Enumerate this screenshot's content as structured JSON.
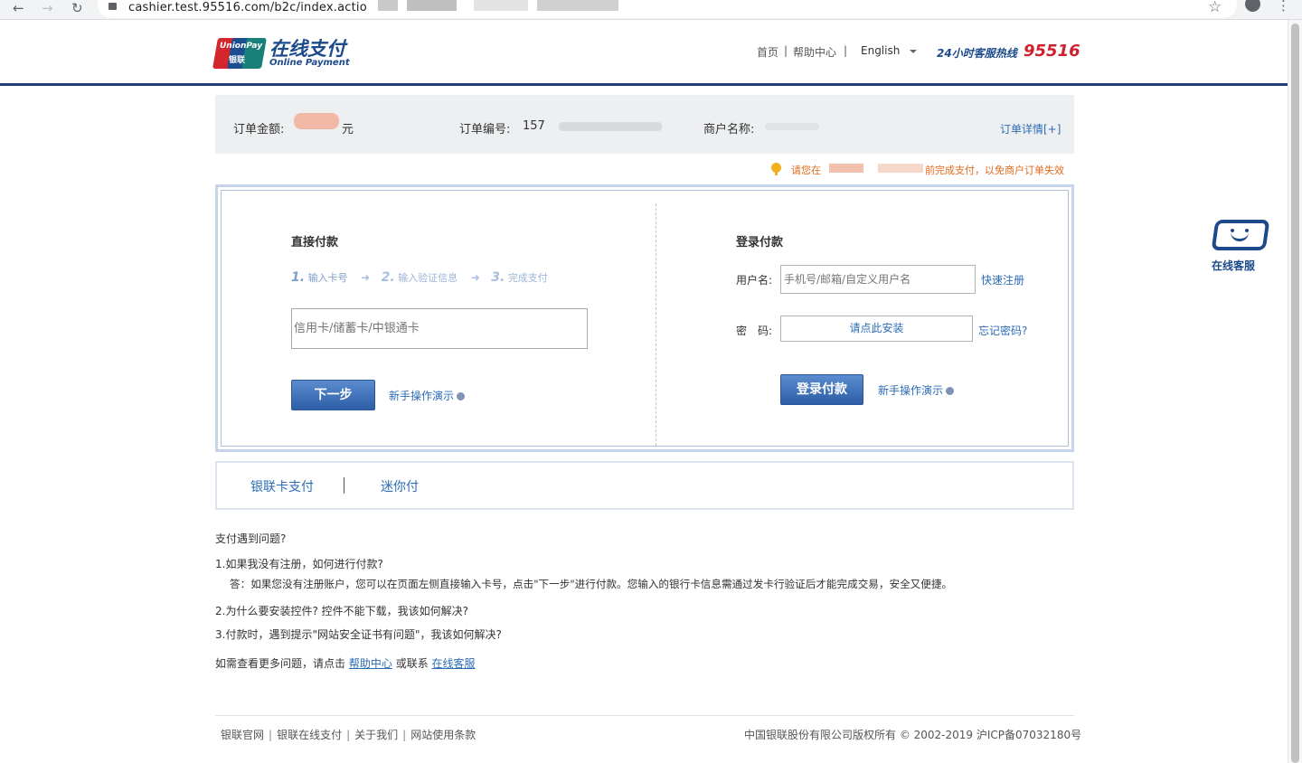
{
  "browser": {
    "url": "cashier.test.95516.com/b2c/index.actio",
    "back_icon": "arrow-left",
    "forward_icon": "arrow-right",
    "reload_icon": "reload",
    "back_glyph": "←",
    "forward_glyph": "→",
    "reload_glyph": "↻",
    "star_glyph": "☆",
    "menu_glyph": "⋮"
  },
  "header": {
    "logo_line1": "UnionPay",
    "logo_line2": "银联",
    "brand_cn": "在线支付",
    "brand_en": "Online Payment",
    "nav": {
      "home": "首页",
      "sep1": "|",
      "help": "帮助中心",
      "sep2": "|",
      "language": "English"
    },
    "hotline_label": "24小时客服热线",
    "hotline_number": "95516"
  },
  "order": {
    "amount_label": "订单金额:",
    "amount_unit": "元",
    "number_label": "订单编号:",
    "number_visible": "157",
    "merchant_label": "商户名称:",
    "detail_link": "订单详情[+]"
  },
  "notice": {
    "prefix": "请您在",
    "suffix": "前完成支付，以免商户订单失效"
  },
  "direct_pay": {
    "title": "直接付款",
    "steps": [
      {
        "num": "1.",
        "label": "输入卡号"
      },
      {
        "num": "2.",
        "label": "输入验证信息"
      },
      {
        "num": "3.",
        "label": "完成支付"
      }
    ],
    "card_placeholder": "信用卡/储蓄卡/中银通卡",
    "next_button": "下一步",
    "demo_link": "新手操作演示"
  },
  "login_pay": {
    "title": "登录付款",
    "username_label": "用户名:",
    "username_placeholder": "手机号/邮箱/自定义用户名",
    "register_link": "快速注册",
    "password_label": "密　码:",
    "password_install": "请点此安装",
    "forgot_link": "忘记密码?",
    "login_button": "登录付款",
    "demo_link": "新手操作演示"
  },
  "tabs": [
    {
      "label": "银联卡支付"
    },
    {
      "label": "迷你付"
    }
  ],
  "faq": {
    "title": "支付遇到问题?",
    "q1": "1.如果我没有注册，如何进行付款?",
    "a1": "答：如果您没有注册账户，您可以在页面左侧直接输入卡号，点击\"下一步\"进行付款。您输入的银行卡信息需通过发卡行验证后才能完成交易，安全又便捷。",
    "q2": "2.为什么要安装控件? 控件不能下载，我该如何解决?",
    "q3": "3.付款时，遇到提示\"网站安全证书有问题\"，我该如何解决?",
    "more_prefix": "如需查看更多问题，请点击",
    "help_link": "帮助中心",
    "more_mid": "或联系",
    "cs_link": "在线客服"
  },
  "footer": {
    "links": [
      "银联官网",
      "银联在线支付",
      "关于我们",
      "网站使用条款"
    ],
    "separator": "|",
    "copyright": "中国银联股份有限公司版权所有 © 2002-2019  沪ICP备07032180号"
  },
  "side_service": {
    "label": "在线客服"
  },
  "colors": {
    "brand_blue": "#1c4a8b",
    "link_blue": "#2c6cb6",
    "hotline_red": "#d0202e",
    "notice_orange": "#e06a1d"
  }
}
